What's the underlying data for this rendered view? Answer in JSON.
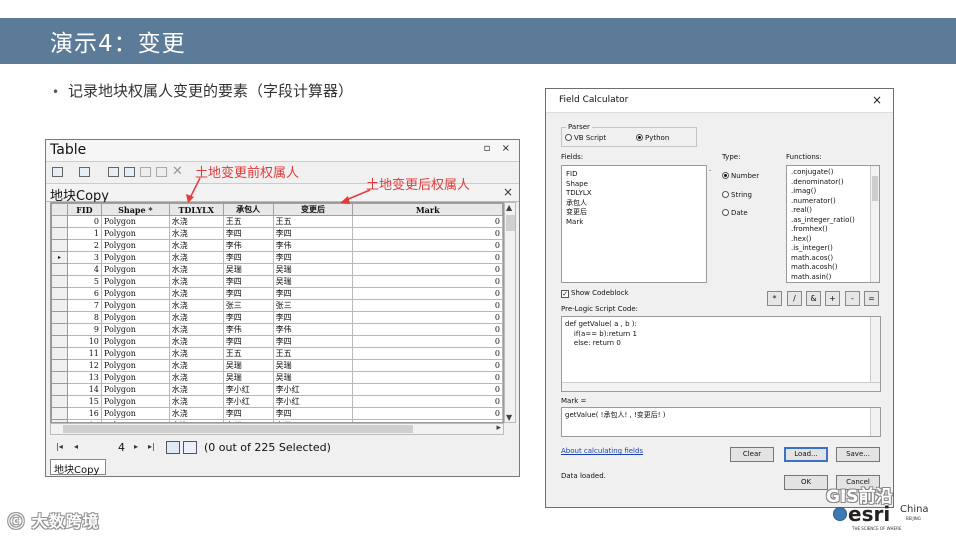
{
  "slide": {
    "title": "演示4：变更",
    "bullet": "记录地块权属人变更的要素（字段计算器）"
  },
  "table_window": {
    "title": "Table",
    "controls": "▫ ×",
    "layer_name": "地块Copy",
    "columns": [
      "FID",
      "Shape *",
      "TDLYLX",
      "承包人",
      "变更后",
      "Mark"
    ],
    "rows": [
      [
        "0",
        "Polygon",
        "水浇",
        "王五",
        "王五",
        "0"
      ],
      [
        "1",
        "Polygon",
        "水浇",
        "李四",
        "李四",
        "0"
      ],
      [
        "2",
        "Polygon",
        "水浇",
        "李伟",
        "李伟",
        "0"
      ],
      [
        "3",
        "Polygon",
        "水浇",
        "李四",
        "李四",
        "0"
      ],
      [
        "4",
        "Polygon",
        "水浇",
        "吴瑞",
        "吴瑞",
        "0"
      ],
      [
        "5",
        "Polygon",
        "水浇",
        "李四",
        "吴瑞",
        "0"
      ],
      [
        "6",
        "Polygon",
        "水浇",
        "李四",
        "李四",
        "0"
      ],
      [
        "7",
        "Polygon",
        "水浇",
        "张三",
        "张三",
        "0"
      ],
      [
        "8",
        "Polygon",
        "水浇",
        "李四",
        "李四",
        "0"
      ],
      [
        "9",
        "Polygon",
        "水浇",
        "李伟",
        "李伟",
        "0"
      ],
      [
        "10",
        "Polygon",
        "水浇",
        "李四",
        "李四",
        "0"
      ],
      [
        "11",
        "Polygon",
        "水浇",
        "王五",
        "王五",
        "0"
      ],
      [
        "12",
        "Polygon",
        "水浇",
        "吴瑞",
        "吴瑞",
        "0"
      ],
      [
        "13",
        "Polygon",
        "水浇",
        "吴瑞",
        "吴瑞",
        "0"
      ],
      [
        "14",
        "Polygon",
        "水浇",
        "李小红",
        "李小红",
        "0"
      ],
      [
        "15",
        "Polygon",
        "水浇",
        "李小红",
        "李小红",
        "0"
      ],
      [
        "16",
        "Polygon",
        "水浇",
        "李四",
        "李四",
        "0"
      ],
      [
        "17",
        "Polygon",
        "水浇",
        "李四",
        "李四",
        "0"
      ]
    ],
    "current_row_marker": "▸",
    "current_row_index": 3,
    "nav": {
      "first": "|◂",
      "prev": "◂",
      "page": "4",
      "next": "▸",
      "last": "▸|",
      "selection_text": "(0 out of 225 Selected)"
    },
    "tab": "地块Copy"
  },
  "annotations": {
    "before": "土地变更前权属人",
    "after": "土地变更后权属人"
  },
  "field_calculator": {
    "title": "Field Calculator",
    "close": "×",
    "parser_label": "Parser",
    "parser_options": [
      "VB Script",
      "Python"
    ],
    "parser_selected": "Python",
    "fields_label": "Fields:",
    "fields": [
      "FID",
      "Shape",
      "TDLYLX",
      "承包人",
      "变更后",
      "Mark"
    ],
    "type_label": "Type:",
    "type_options": [
      "Number",
      "String",
      "Date"
    ],
    "type_selected": "Number",
    "functions_label": "Functions:",
    "functions": [
      ".conjugate()",
      ".denominator()",
      ".imag()",
      ".numerator()",
      ".real()",
      ".as_integer_ratio()",
      ".fromhex()",
      ".hex()",
      ".is_integer()",
      "math.acos()",
      "math.acosh()",
      "math.asin()"
    ],
    "show_codeblock_label": "Show Codeblock",
    "show_codeblock_checked": true,
    "operators": [
      "*",
      "/",
      "&",
      "+",
      "-",
      "="
    ],
    "prelogic_label": "Pre-Logic Script Code:",
    "prelogic_code": [
      "def getValue( a , b ):",
      "    if(a== b):return 1",
      "    else: return 0"
    ],
    "expression_label": "Mark =",
    "expression": "getValue( !承包人! , !变更后! )",
    "about_link": "About calculating fields",
    "clear_button": "Clear",
    "load_button": "Load...",
    "save_button": "Save...",
    "status_text": "Data loaded.",
    "ok_button": "OK",
    "cancel_button": "Cancel"
  },
  "watermarks": {
    "left": "大数跨境",
    "right": "GIS前沿",
    "esri": "esri",
    "esri_china": "China",
    "esri_city": "BEIJING",
    "esri_tagline": "THE SCIENCE OF WHERE"
  }
}
